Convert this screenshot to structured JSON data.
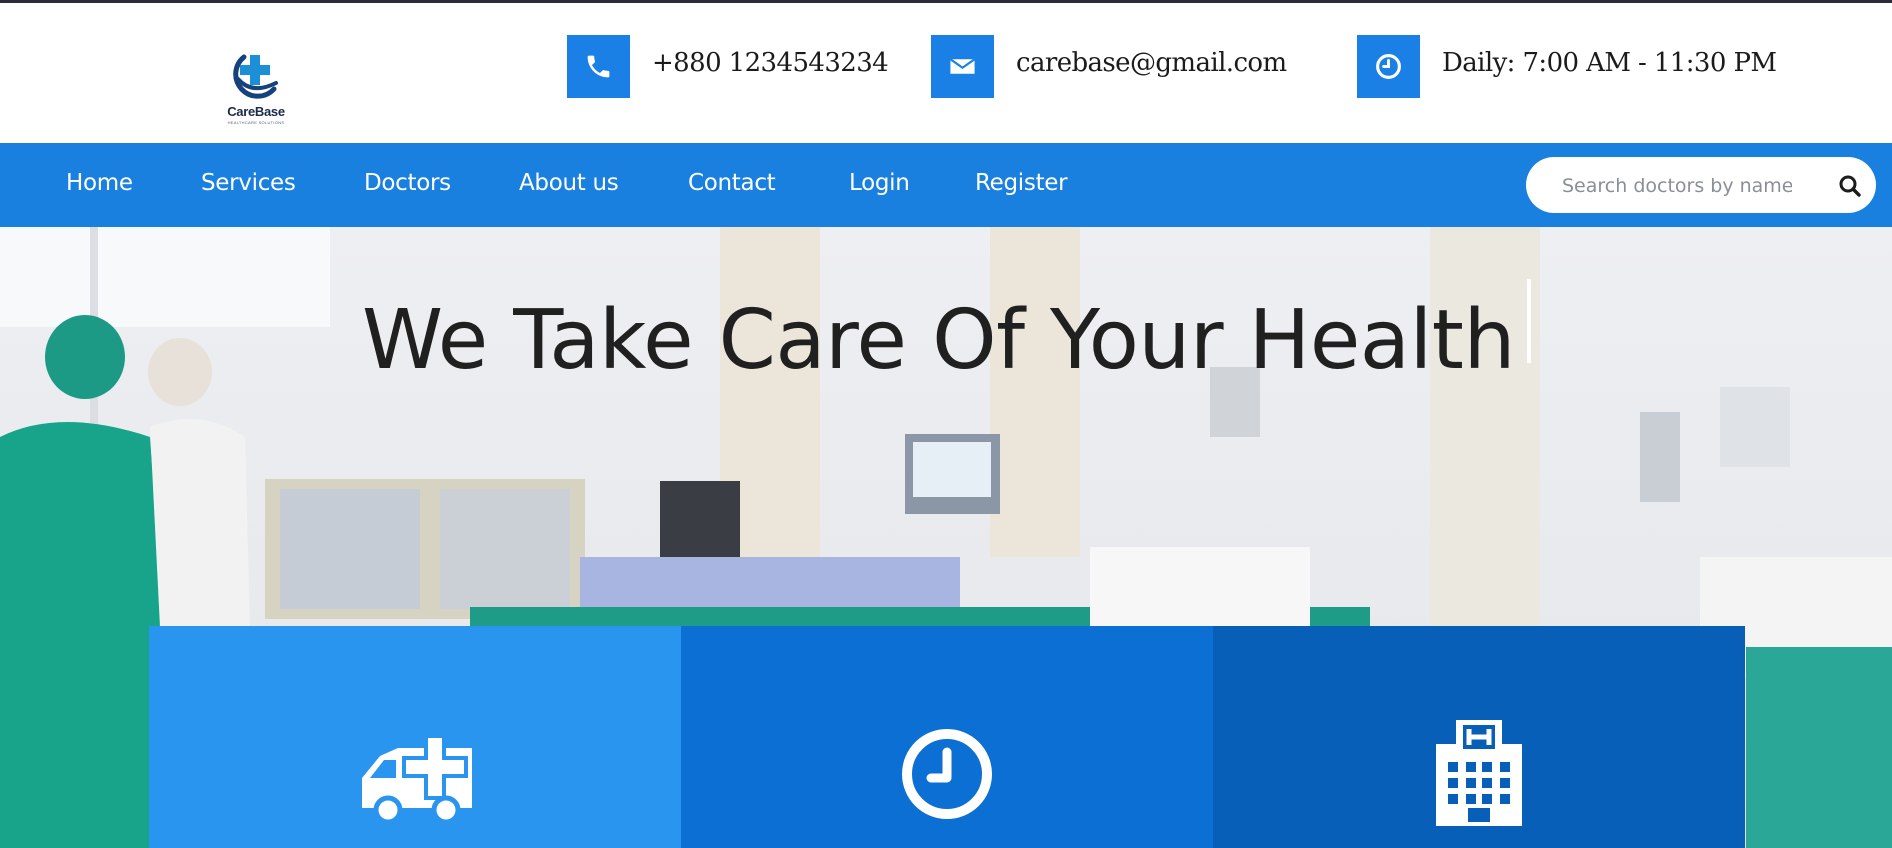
{
  "brand": {
    "name": "CareBase",
    "tagline": "HEALTHCARE SOLUTIONS"
  },
  "contacts": {
    "phone": {
      "icon": "phone-icon",
      "text": "+880 1234543234"
    },
    "email": {
      "icon": "envelope-icon",
      "text": "carebase@gmail.com"
    },
    "hours": {
      "icon": "clock-icon",
      "text": "Daily: 7:00 AM - 11:30 PM"
    }
  },
  "nav": {
    "items": [
      {
        "label": "Home"
      },
      {
        "label": "Services"
      },
      {
        "label": "Doctors"
      },
      {
        "label": "About us"
      },
      {
        "label": "Contact"
      },
      {
        "label": "Login"
      },
      {
        "label": "Register"
      }
    ],
    "search": {
      "placeholder": "Search doctors by name",
      "icon": "search-icon"
    }
  },
  "hero": {
    "title": "We Take Care Of Your Health"
  },
  "features": [
    {
      "icon": "ambulance-icon",
      "color": "#2a95ef"
    },
    {
      "icon": "clock-icon",
      "color": "#0b6fd4"
    },
    {
      "icon": "hospital-icon",
      "color": "#075fb8"
    }
  ],
  "colors": {
    "primary": "#1a80e0",
    "header_bg": "#ffffff",
    "title_text": "#202020"
  }
}
